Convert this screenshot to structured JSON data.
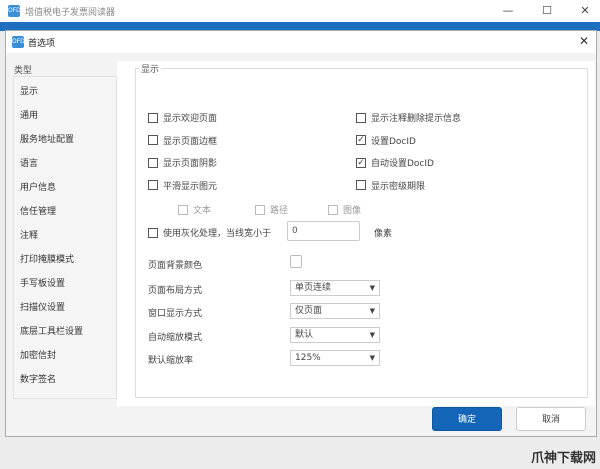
{
  "app": {
    "title": "增值税电子发票阅读器",
    "icon": "app-logo-icon",
    "icon_text": "OFD"
  },
  "window_controls": {
    "minimize": "—",
    "maximize": "☐",
    "close": "✕"
  },
  "dialog": {
    "title": "首选项",
    "close": "✕"
  },
  "sidebar": {
    "heading": "类型",
    "items": [
      {
        "label": "显示"
      },
      {
        "label": "通用"
      },
      {
        "label": "服务地址配置"
      },
      {
        "label": "语言"
      },
      {
        "label": "用户信息"
      },
      {
        "label": "信任管理"
      },
      {
        "label": "注释"
      },
      {
        "label": "打印掩膜模式"
      },
      {
        "label": "手写板设置"
      },
      {
        "label": "扫描仪设置"
      },
      {
        "label": "底层工具栏设置"
      },
      {
        "label": "加密信封"
      },
      {
        "label": "数字签名"
      }
    ],
    "selected": "显示"
  },
  "display": {
    "group_title": "显示",
    "left_checks": [
      {
        "label": "显示欢迎页面",
        "checked": false
      },
      {
        "label": "显示页面边框",
        "checked": false
      },
      {
        "label": "显示页面阴影",
        "checked": false
      },
      {
        "label": "平滑显示图元",
        "checked": false
      }
    ],
    "right_checks": [
      {
        "label": "显示注释删除提示信息",
        "checked": false
      },
      {
        "label": "设置DocID",
        "checked": true
      },
      {
        "label": "自动设置DocID",
        "checked": true
      },
      {
        "label": "显示密级期限",
        "checked": false
      }
    ],
    "smooth_sub": [
      {
        "label": "文本",
        "checked": false
      },
      {
        "label": "路径",
        "checked": false
      },
      {
        "label": "图像",
        "checked": false
      }
    ],
    "gray": {
      "label": "使用灰化处理，当线宽小于",
      "checked": false,
      "value": "0",
      "unit": "像素"
    },
    "bg_color_label": "页面背景颜色",
    "bg_color": "#ffffff",
    "selects": [
      {
        "label": "页面布局方式",
        "value": "单页连续"
      },
      {
        "label": "窗口显示方式",
        "value": "仅页面"
      },
      {
        "label": "自动缩放模式",
        "value": "默认"
      },
      {
        "label": "默认缩放率",
        "value": "125%"
      }
    ]
  },
  "buttons": {
    "ok": "确定",
    "cancel": "取消"
  },
  "colors": {
    "accent": "#1565b8"
  },
  "watermark": "爪神下载网"
}
